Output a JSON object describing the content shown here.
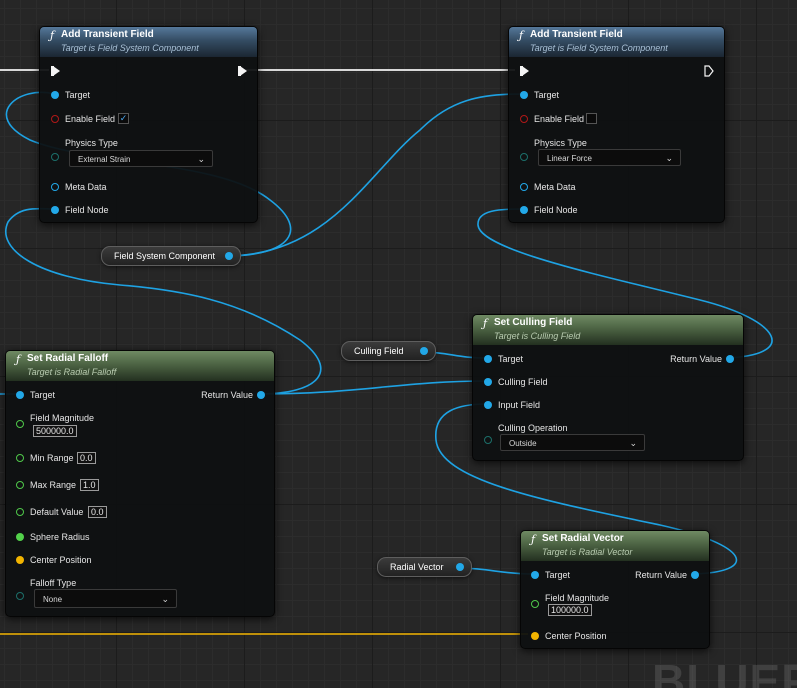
{
  "nodes": {
    "transient1": {
      "title": "Add Transient Field",
      "subtitle": "Target is Field System Component",
      "target": "Target",
      "enable_field": "Enable Field",
      "enable_checked": "✓",
      "physics_type": "Physics Type",
      "physics_value": "External Strain",
      "meta_data": "Meta Data",
      "field_node": "Field Node"
    },
    "transient2": {
      "title": "Add Transient Field",
      "subtitle": "Target is Field System Component",
      "target": "Target",
      "enable_field": "Enable Field",
      "enable_checked": "",
      "physics_type": "Physics Type",
      "physics_value": "Linear Force",
      "meta_data": "Meta Data",
      "field_node": "Field Node"
    },
    "culling": {
      "title": "Set Culling Field",
      "subtitle": "Target is Culling Field",
      "target": "Target",
      "return_value": "Return Value",
      "culling_field": "Culling Field",
      "input_field": "Input Field",
      "culling_operation": "Culling Operation",
      "operation_value": "Outside"
    },
    "falloff": {
      "title": "Set Radial Falloff",
      "subtitle": "Target is Radial Falloff",
      "target": "Target",
      "return_value": "Return Value",
      "field_magnitude": "Field Magnitude",
      "field_magnitude_value": "500000.0",
      "min_range": "Min Range",
      "min_range_value": "0.0",
      "max_range": "Max Range",
      "max_range_value": "1.0",
      "default_value": "Default Value",
      "default_value_value": "0.0",
      "sphere_radius": "Sphere Radius",
      "center_position": "Center Position",
      "falloff_type": "Falloff Type",
      "falloff_type_value": "None"
    },
    "vector": {
      "title": "Set Radial Vector",
      "subtitle": "Target is Radial Vector",
      "target": "Target",
      "return_value": "Return Value",
      "field_magnitude": "Field Magnitude",
      "field_magnitude_value": "100000.0",
      "center_position": "Center Position"
    }
  },
  "variables": {
    "field_system_component": "Field System Component",
    "culling_field": "Culling Field",
    "radial_vector": "Radial Vector"
  },
  "watermark": "BLUEPRINT",
  "icons": {
    "function": "ƒ",
    "dropdown": "⌄"
  },
  "colors": {
    "object_pin": "#22a8e8",
    "bool_pin": "#b01818",
    "float_pin": "#53d24b",
    "vector_pin": "#f2b400",
    "enum_pin": "#1c6f6a",
    "exec_pin": "#f4f4f4",
    "header_target_blue": "#344c63",
    "header_pure_green": "#4c6343"
  }
}
